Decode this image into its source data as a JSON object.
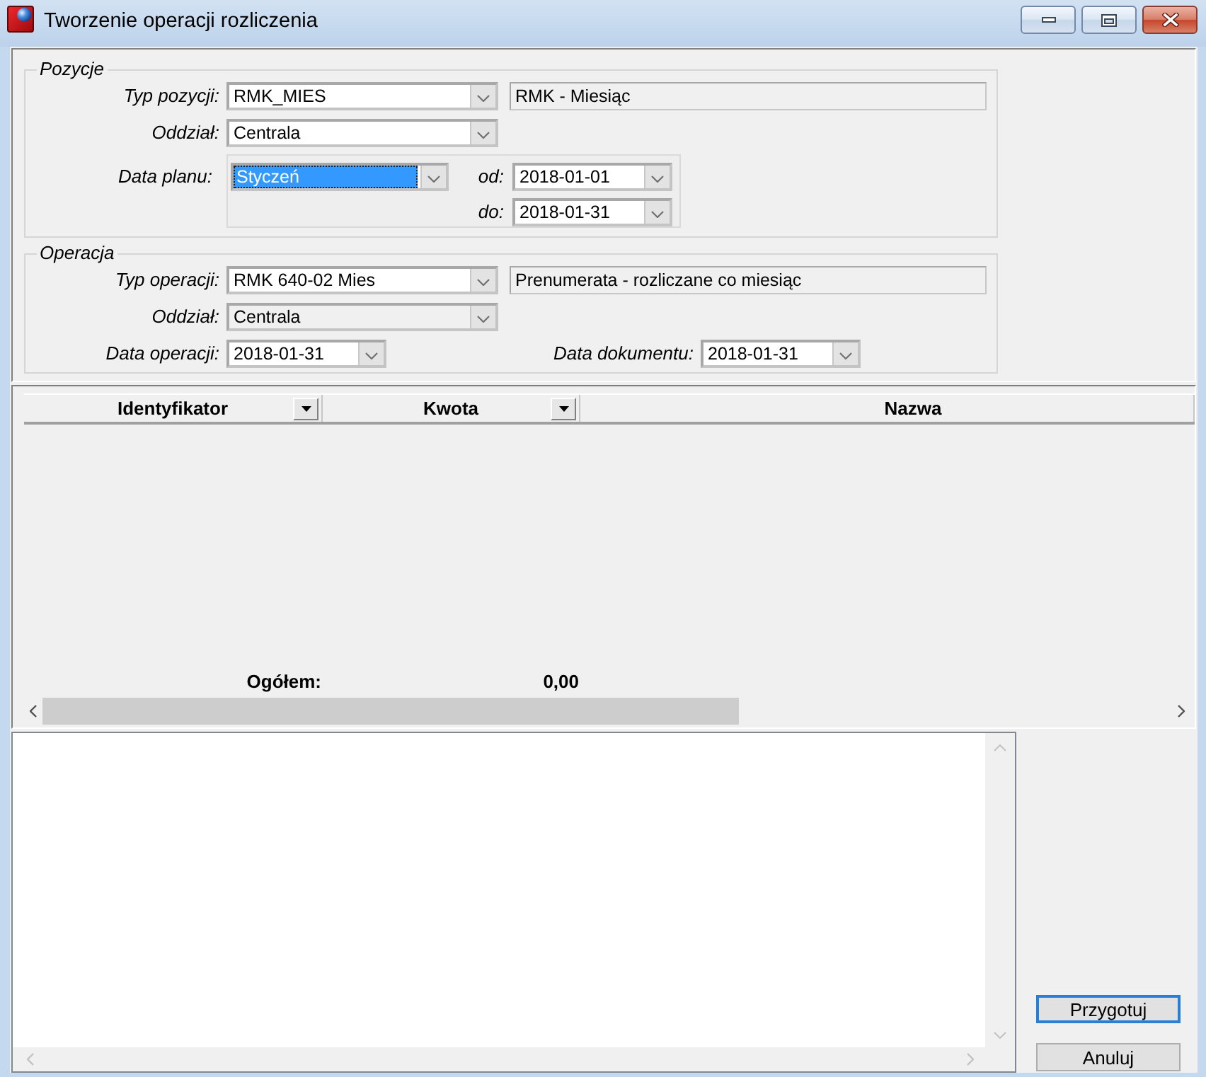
{
  "window": {
    "title": "Tworzenie operacji rozliczenia"
  },
  "pozycje": {
    "legend": "Pozycje",
    "typ_pozycji": {
      "label": "Typ pozycji:",
      "value": "RMK_MIES",
      "disabled": false,
      "description": "RMK - Miesiąc"
    },
    "oddzial": {
      "label": "Oddział:",
      "value": "Centrala",
      "disabled": false
    },
    "data_planu": {
      "label": "Data planu:",
      "value": "Styczeń",
      "focused": true
    },
    "od": {
      "label": "od:",
      "value": "2018-01-01"
    },
    "do": {
      "label": "do:",
      "value": "2018-01-31"
    }
  },
  "operacja": {
    "legend": "Operacja",
    "typ_operacji": {
      "label": "Typ operacji:",
      "value": "RMK 640-02 Mies",
      "disabled": false,
      "description": "Prenumerata - rozliczane co miesiąc"
    },
    "oddzial": {
      "label": "Oddział:",
      "value": "Centrala",
      "disabled": true
    },
    "data_operacji": {
      "label": "Data operacji:",
      "value": "2018-01-31"
    },
    "data_dokumentu": {
      "label": "Data dokumentu:",
      "value": "2018-01-31"
    }
  },
  "table": {
    "columns": [
      {
        "label": "Identyfikator",
        "filter": true
      },
      {
        "label": "Kwota",
        "filter": true
      },
      {
        "label": "Nazwa",
        "filter": false
      }
    ],
    "total_label": "Ogółem:",
    "total_value": "0,00"
  },
  "buttons": [
    {
      "label": "Przygotuj",
      "focused": true
    },
    {
      "label": "Anuluj",
      "focused": false
    }
  ]
}
